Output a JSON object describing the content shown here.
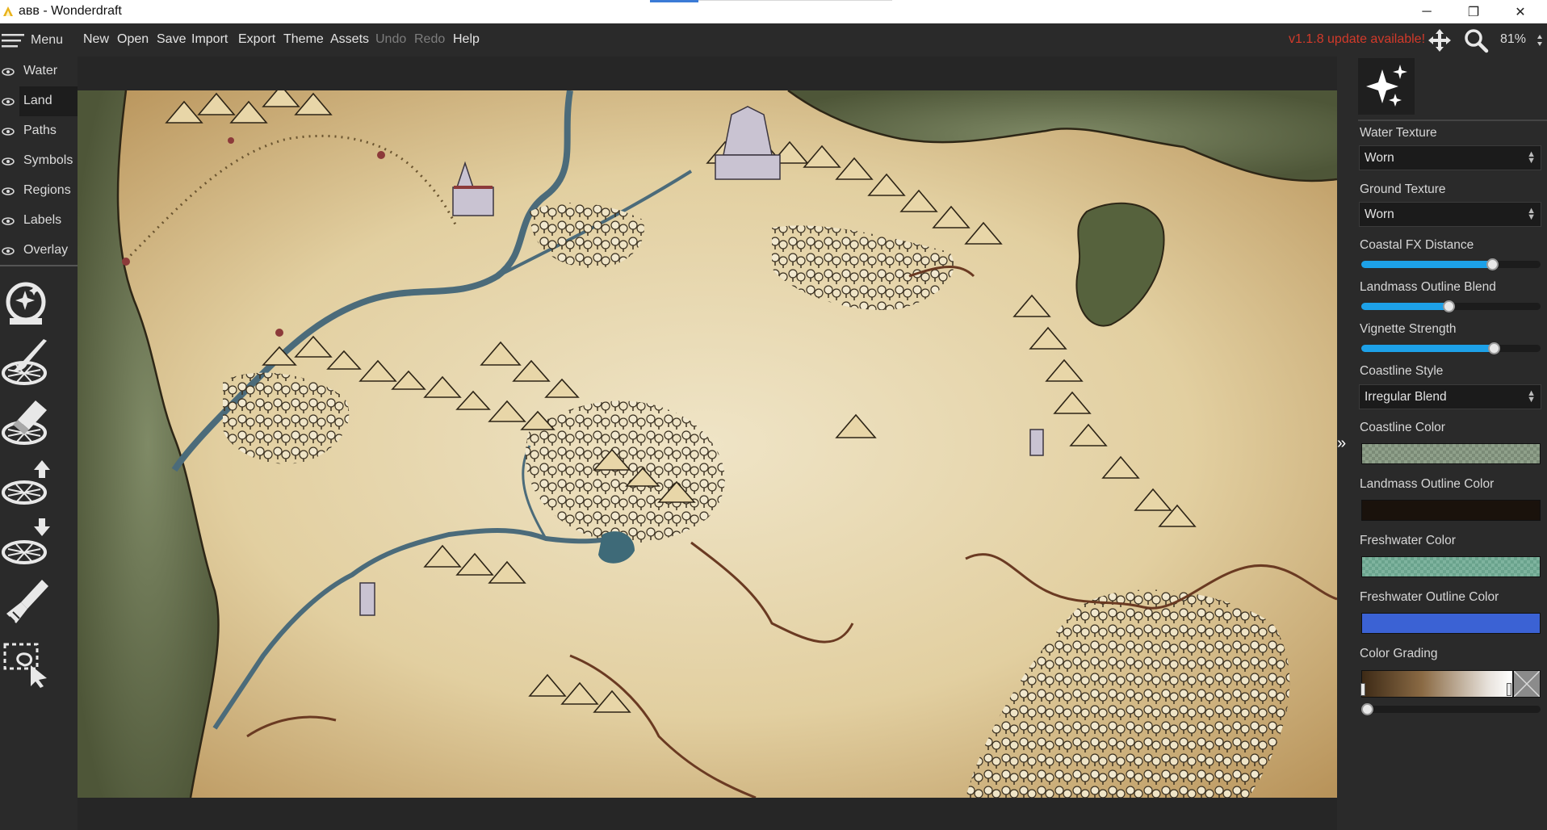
{
  "window": {
    "title": "авв - Wonderdraft",
    "minimize": "─",
    "restore": "❐",
    "close": "✕"
  },
  "menubar": {
    "menu_label": "Menu",
    "items": [
      "New",
      "Open",
      "Save",
      "Import",
      "Export",
      "Theme",
      "Assets"
    ],
    "disabled_items": [
      "Undo",
      "Redo"
    ],
    "help": "Help",
    "update_notice": "v1.1.8 update available!",
    "zoom": "81%",
    "update_color": "#d23a2a"
  },
  "layers": [
    {
      "label": "Water",
      "active": false
    },
    {
      "label": "Land",
      "active": true
    },
    {
      "label": "Paths",
      "active": false
    },
    {
      "label": "Symbols",
      "active": false
    },
    {
      "label": "Regions",
      "active": false
    },
    {
      "label": "Labels",
      "active": false
    },
    {
      "label": "Overlay",
      "active": false
    }
  ],
  "tools": [
    {
      "icon": "magic-globe-icon"
    },
    {
      "icon": "land-brush-icon"
    },
    {
      "icon": "land-eraser-icon"
    },
    {
      "icon": "raise-land-icon"
    },
    {
      "icon": "lower-land-icon"
    },
    {
      "icon": "paint-brush-icon"
    },
    {
      "icon": "lasso-select-icon"
    }
  ],
  "panel": {
    "collapse_glyph": "»",
    "water_texture": {
      "label": "Water Texture",
      "value": "Worn"
    },
    "ground_texture": {
      "label": "Ground Texture",
      "value": "Worn"
    },
    "coastal_fx": {
      "label": "Coastal FX Distance",
      "value": 0.75
    },
    "outline_blend": {
      "label": "Landmass Outline Blend",
      "value": 0.49
    },
    "vignette": {
      "label": "Vignette Strength",
      "value": 0.76
    },
    "coastline_style": {
      "label": "Coastline Style",
      "value": "Irregular Blend"
    },
    "coastline_color": {
      "label": "Coastline Color",
      "color": "#8fa08a"
    },
    "landmass_outline_color": {
      "label": "Landmass Outline Color",
      "color": "#1a120c"
    },
    "freshwater_color": {
      "label": "Freshwater Color",
      "color": "#7eb39e"
    },
    "freshwater_outline_color": {
      "label": "Freshwater Outline Color",
      "color": "#3b62d4"
    },
    "color_grading": {
      "label": "Color Grading",
      "value": 0.0
    }
  }
}
